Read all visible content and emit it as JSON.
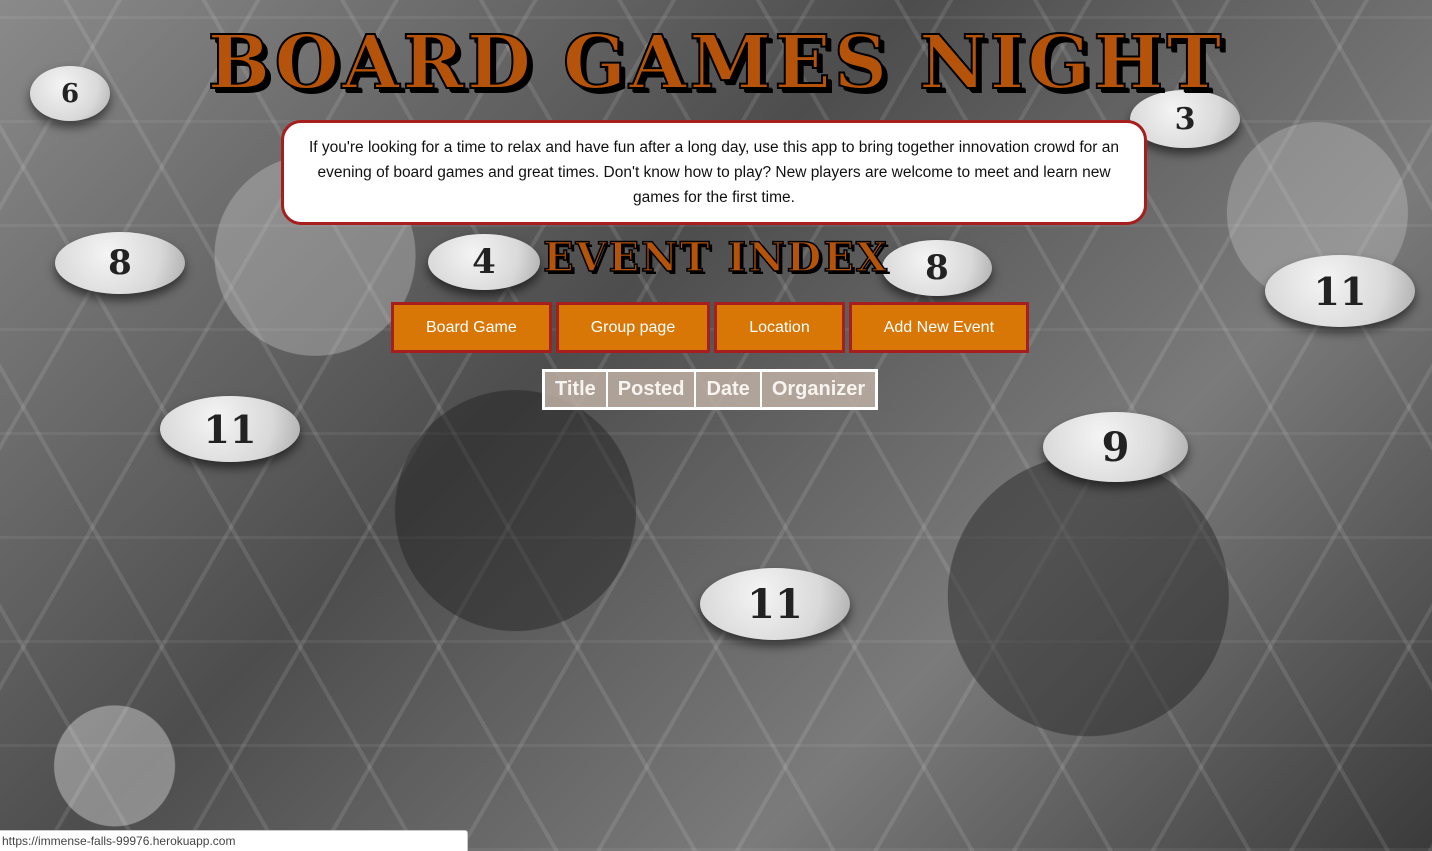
{
  "page": {
    "title": "BOARD GAMES NIGHT",
    "intro": "If you're looking for a time to relax and have fun after a long day, use this app to bring together innovation crowd for an evening of board games and great times. Don't know how to play? New players are welcome to meet and learn new games for the first time.",
    "section_title": "EVENT INDEX"
  },
  "nav": {
    "items": [
      {
        "label": "Board Game"
      },
      {
        "label": "Group page"
      },
      {
        "label": "Location"
      },
      {
        "label": "Add New Event"
      }
    ]
  },
  "events_table": {
    "columns": [
      "Title",
      "Posted",
      "Date",
      "Organizer"
    ]
  },
  "background": {
    "tokens": [
      "6",
      "8",
      "4",
      "8",
      "3",
      "11",
      "11",
      "9",
      "11"
    ]
  },
  "status_bar": {
    "url": "https://immense-falls-99976.herokuapp.com"
  },
  "colors": {
    "accent_orange": "#d97706",
    "title_brown": "#b45309",
    "border_red": "#a61e1e"
  }
}
